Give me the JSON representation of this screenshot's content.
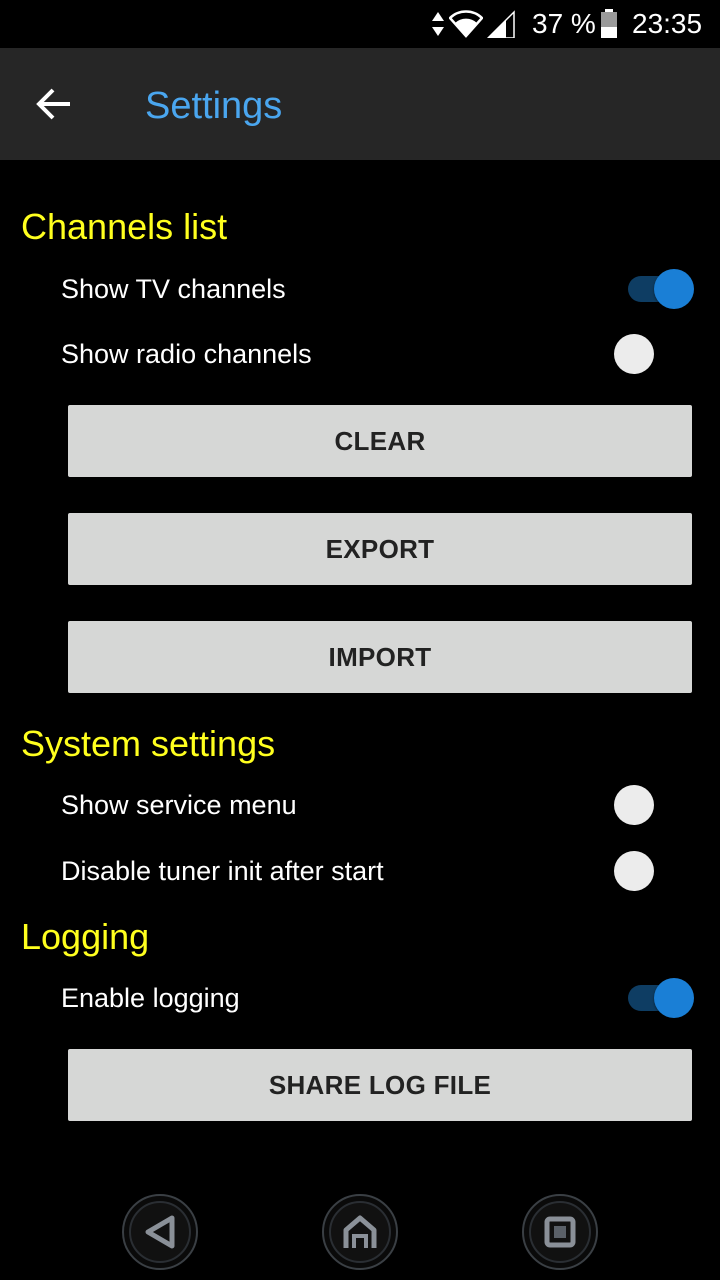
{
  "status_bar": {
    "battery_percent": "37 %",
    "time": "23:35",
    "icons": [
      "network-arrows-icon",
      "wifi-icon",
      "cell-signal-icon",
      "battery-icon"
    ]
  },
  "toolbar": {
    "back_icon": "arrow-left-icon",
    "title": "Settings"
  },
  "sections": {
    "channels": {
      "header": "Channels list",
      "show_tv": {
        "label": "Show TV channels",
        "checked": true
      },
      "show_radio": {
        "label": "Show radio channels",
        "checked": false
      },
      "clear_button": "CLEAR",
      "export_button": "EXPORT",
      "import_button": "IMPORT"
    },
    "system": {
      "header": "System settings",
      "service_menu": {
        "label": "Show service menu",
        "checked": false
      },
      "tuner_init": {
        "label": "Disable tuner init after start",
        "checked": false
      }
    },
    "logging": {
      "header": "Logging",
      "enable_logging": {
        "label": "Enable logging",
        "checked": true
      },
      "share_button": "SHARE LOG FILE"
    }
  },
  "nav_bar": {
    "icons": [
      "nav-back-icon",
      "nav-home-icon",
      "nav-recents-icon"
    ]
  },
  "colors": {
    "accent": "#4aa6ef",
    "section_header": "#ffff1e",
    "switch_on": "#1a7fd6",
    "toolbar_bg": "#262626",
    "button_bg": "#d6d7d6"
  }
}
